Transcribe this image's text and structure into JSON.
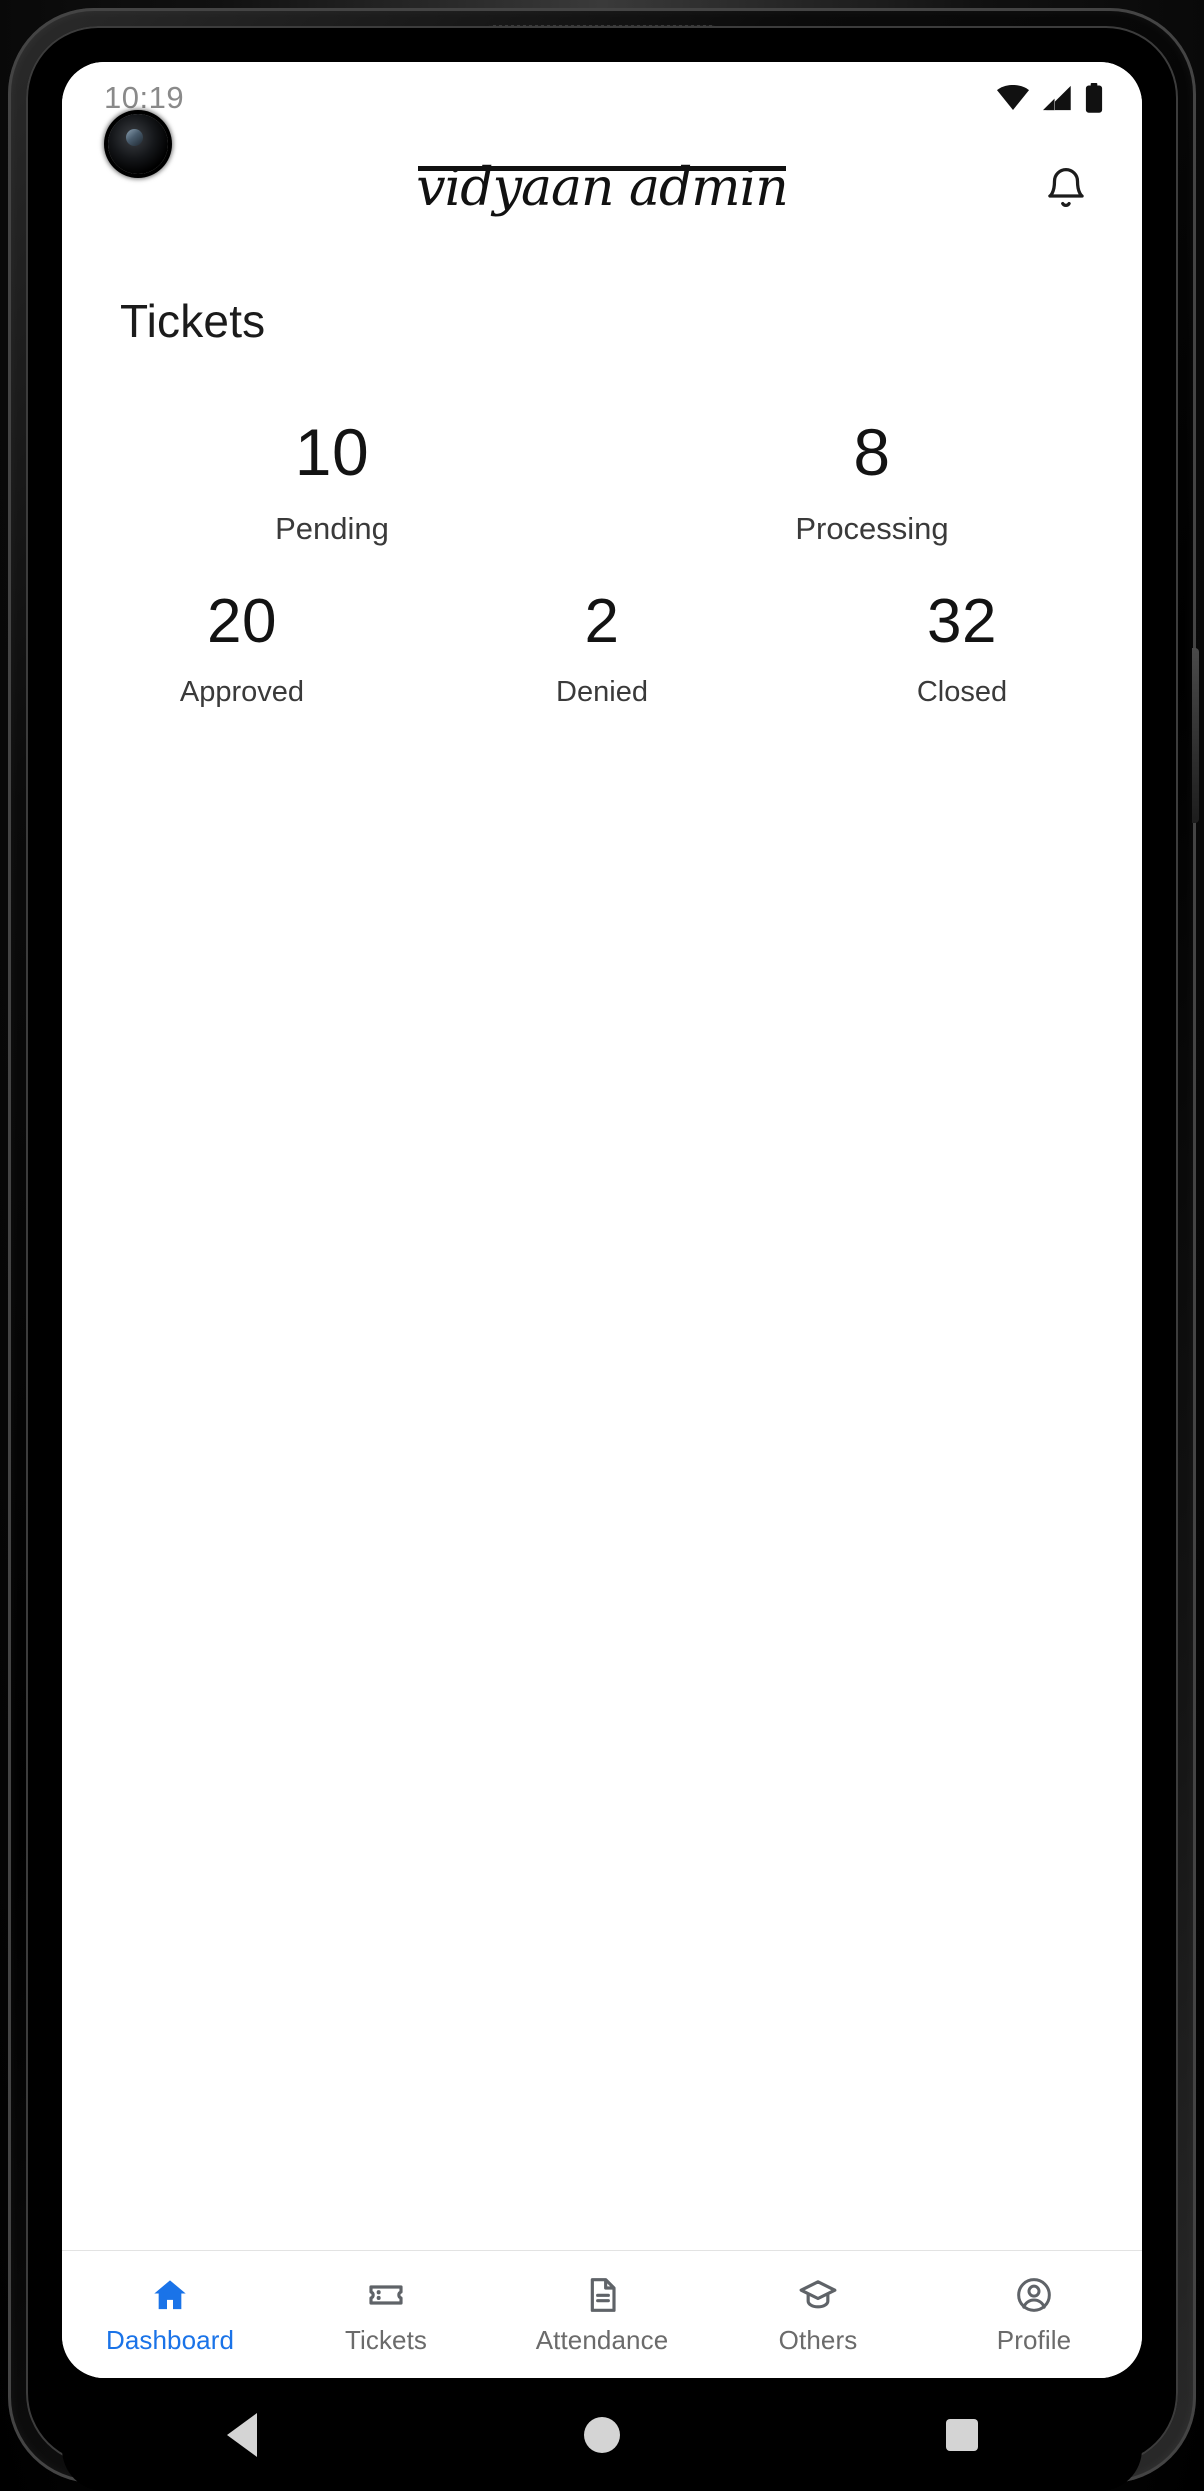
{
  "status_bar": {
    "time": "10:19",
    "icons": [
      "wifi-icon",
      "cellular-signal-icon",
      "battery-icon"
    ]
  },
  "header": {
    "app_title": "vidyaan admin",
    "notification_icon": "bell-icon"
  },
  "main": {
    "section_title": "Tickets",
    "stats_primary": [
      {
        "value": "10",
        "label": "Pending"
      },
      {
        "value": "8",
        "label": "Processing"
      }
    ],
    "stats_secondary": [
      {
        "value": "20",
        "label": "Approved"
      },
      {
        "value": "2",
        "label": "Denied"
      },
      {
        "value": "32",
        "label": "Closed"
      }
    ]
  },
  "bottom_nav": {
    "active_index": 0,
    "items": [
      {
        "label": "Dashboard",
        "icon": "home-icon"
      },
      {
        "label": "Tickets",
        "icon": "ticket-icon"
      },
      {
        "label": "Attendance",
        "icon": "document-icon"
      },
      {
        "label": "Others",
        "icon": "graduation-cap-icon"
      },
      {
        "label": "Profile",
        "icon": "account-circle-icon"
      }
    ]
  },
  "system_nav": {
    "buttons": [
      "back-button",
      "home-button",
      "recent-apps-button"
    ]
  },
  "colors": {
    "accent": "#1a73e8",
    "inactive": "#6b6b6b",
    "text_primary": "#131313",
    "background": "#ffffff"
  }
}
